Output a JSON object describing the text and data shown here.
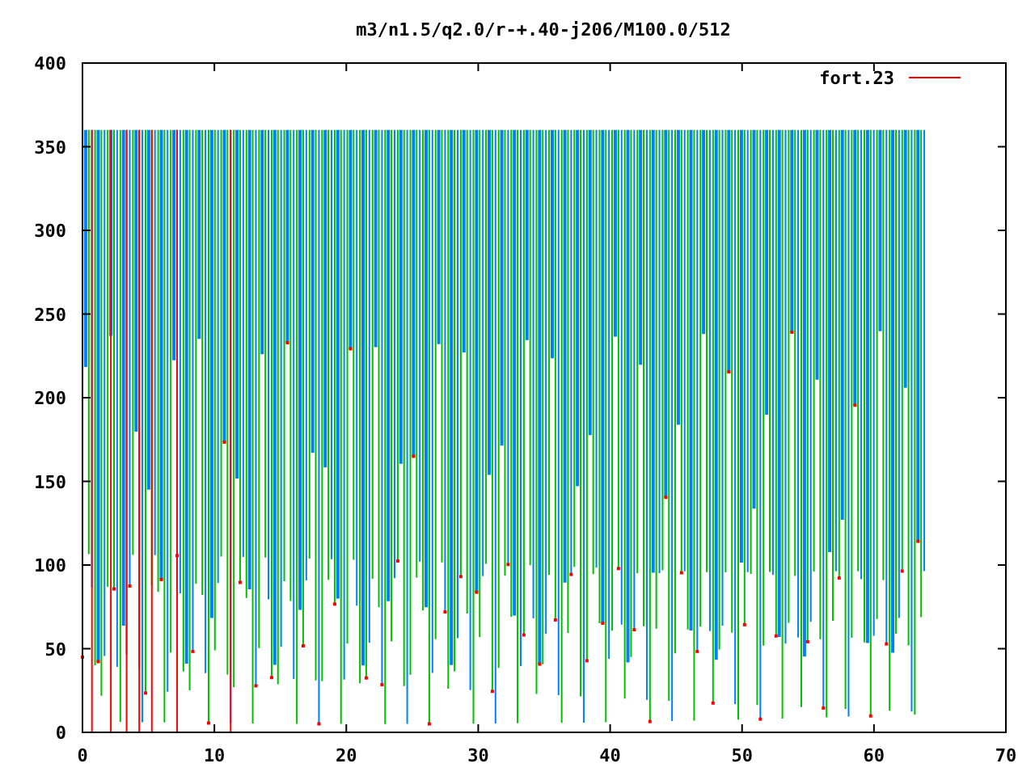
{
  "title": "m3/n1.5/q2.0/r-+.40-j206/M100.0/512",
  "legend": {
    "label": "fort.23"
  },
  "x_axis": {
    "ticks": [
      "0",
      "10",
      "20",
      "30",
      "40",
      "50",
      "60",
      "70"
    ]
  },
  "y_axis": {
    "ticks": [
      "400",
      "350",
      "300",
      "250",
      "200",
      "150",
      "100",
      "50",
      "0"
    ]
  }
}
